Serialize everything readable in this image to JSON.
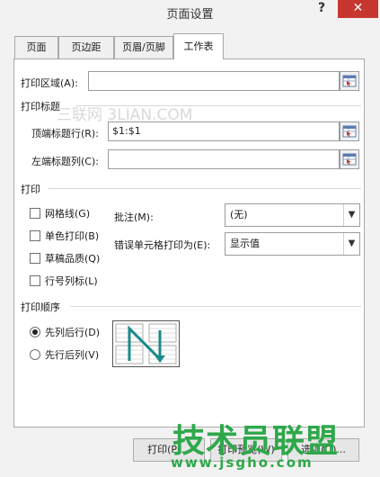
{
  "window": {
    "title": "页面设置",
    "help": "?",
    "close": "✕"
  },
  "tabs": [
    {
      "label": "页面"
    },
    {
      "label": "页边距"
    },
    {
      "label": "页眉/页脚"
    },
    {
      "label": "工作表"
    }
  ],
  "print_area": {
    "label": "打印区域(A):",
    "value": ""
  },
  "print_titles": {
    "group_label": "打印标题",
    "rows_label": "顶端标题行(R):",
    "rows_value": "$1:$1",
    "cols_label": "左端标题列(C):",
    "cols_value": ""
  },
  "print": {
    "group_label": "打印",
    "gridlines": "网格线(G)",
    "black_white": "单色打印(B)",
    "draft": "草稿品质(Q)",
    "row_col_headings": "行号列标(L)",
    "comments_label": "批注(M):",
    "comments_value": "(无)",
    "errors_label": "错误单元格打印为(E):",
    "errors_value": "显示值"
  },
  "page_order": {
    "group_label": "打印顺序",
    "down_then_over": "先列后行(D)",
    "over_then_down": "先行后列(V)",
    "selected": "down_then_over"
  },
  "buttons": {
    "print": "打印(P)...",
    "preview": "打印预览(W)",
    "options": "选项(O)..."
  },
  "watermark": "三联网 3LIAN.COM",
  "logo": {
    "text": "技术员联盟",
    "url": "www.jsgho.com"
  },
  "colors": {
    "close": "#c7372f",
    "logo": "#2ea84a",
    "arrow": "#1a8a8a"
  }
}
